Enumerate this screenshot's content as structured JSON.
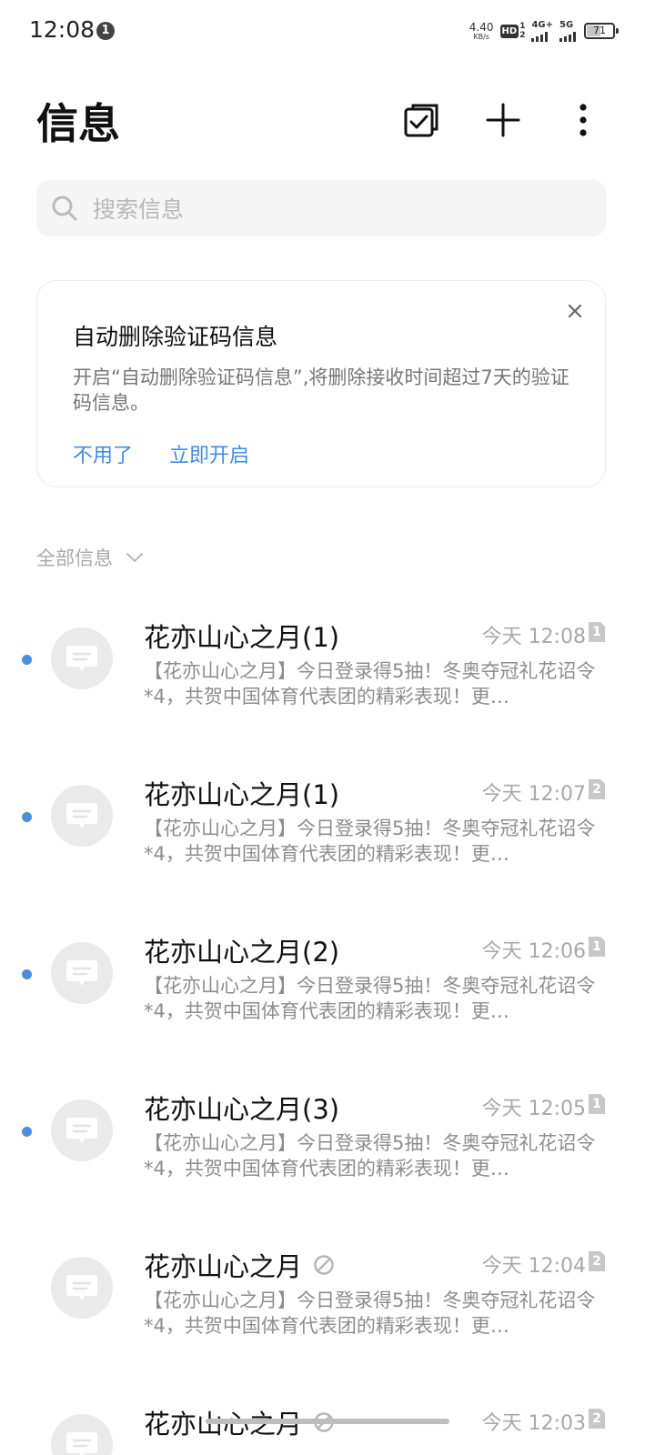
{
  "status_bar": {
    "time": "12:08",
    "notif_count": "1",
    "speed_value": "4.40",
    "speed_unit": "KB/s",
    "hd_label": "HD",
    "hd_sim1": "1",
    "hd_sim2": "2",
    "net1": "4G+",
    "net2": "5G",
    "battery": "71",
    "battery_level_percent": 71
  },
  "header": {
    "title": "信息",
    "icons": [
      "select-messages-icon",
      "add-icon",
      "more-options-icon"
    ]
  },
  "search": {
    "placeholder": "搜索信息"
  },
  "promo_card": {
    "title": "自动删除验证码信息",
    "description": "开启“自动删除验证码信息”,将删除接收时间超过7天的验证码信息。",
    "dismiss_label": "不用了",
    "enable_label": "立即开启"
  },
  "filter": {
    "label": "全部信息"
  },
  "messages": [
    {
      "sender": "花亦山心之月(1)",
      "time": "今天 12:08",
      "sim": "1",
      "preview": "【花亦山心之月】今日登录得5抽！冬奥夺冠礼花诏令*4，共贺中国体育代表团的精彩表现！更…",
      "unread": true,
      "blocked": false
    },
    {
      "sender": "花亦山心之月(1)",
      "time": "今天 12:07",
      "sim": "2",
      "preview": "【花亦山心之月】今日登录得5抽！冬奥夺冠礼花诏令*4，共贺中国体育代表团的精彩表现！更…",
      "unread": true,
      "blocked": false
    },
    {
      "sender": "花亦山心之月(2)",
      "time": "今天 12:06",
      "sim": "1",
      "preview": "【花亦山心之月】今日登录得5抽！冬奥夺冠礼花诏令*4，共贺中国体育代表团的精彩表现！更…",
      "unread": true,
      "blocked": false
    },
    {
      "sender": "花亦山心之月(3)",
      "time": "今天 12:05",
      "sim": "1",
      "preview": "【花亦山心之月】今日登录得5抽！冬奥夺冠礼花诏令*4，共贺中国体育代表团的精彩表现！更…",
      "unread": true,
      "blocked": false
    },
    {
      "sender": "花亦山心之月",
      "time": "今天 12:04",
      "sim": "2",
      "preview": "【花亦山心之月】今日登录得5抽！冬奥夺冠礼花诏令*4，共贺中国体育代表团的精彩表现！更…",
      "unread": false,
      "blocked": true
    },
    {
      "sender": "花亦山心之月",
      "time": "今天 12:03",
      "sim": "2",
      "preview": "",
      "unread": false,
      "blocked": true
    }
  ]
}
